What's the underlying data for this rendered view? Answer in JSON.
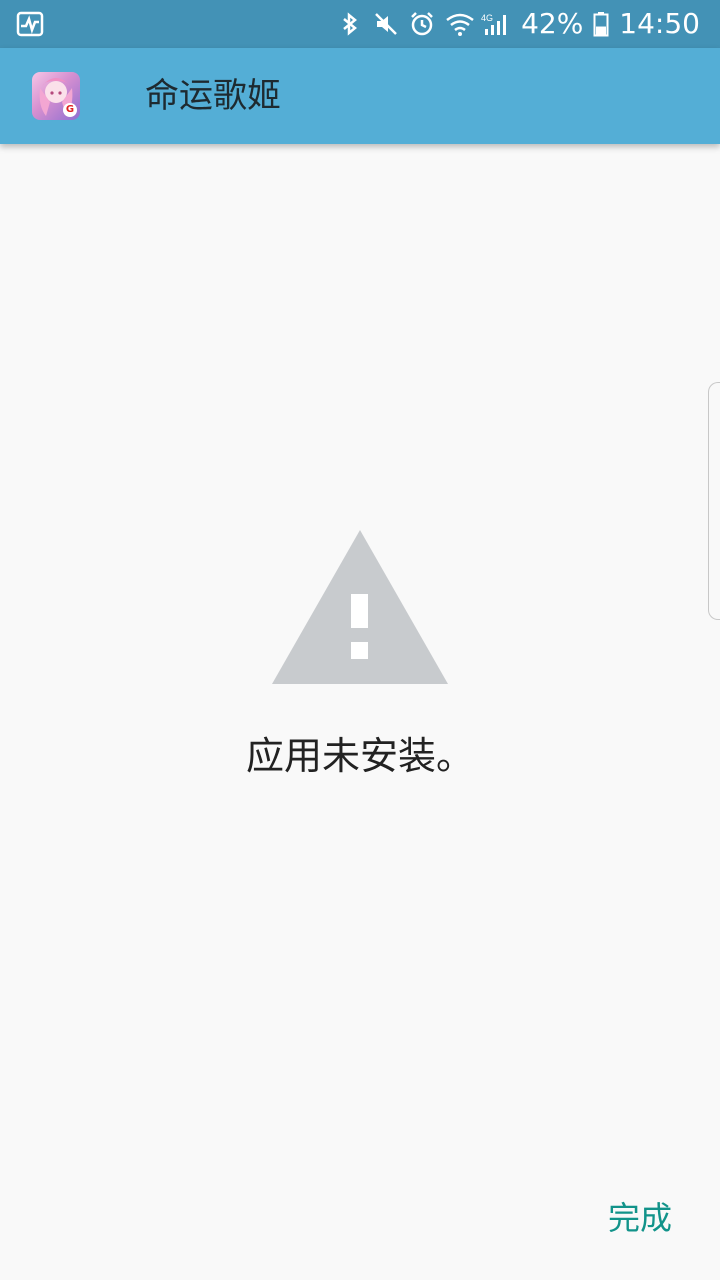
{
  "status_bar": {
    "battery_percent": "42%",
    "time": "14:50",
    "network_label": "4G",
    "icons": [
      "activity-icon",
      "bluetooth-icon",
      "mute-icon",
      "alarm-icon",
      "wifi-icon",
      "signal-icon",
      "battery-icon"
    ],
    "battery_level": 0.42
  },
  "app_bar": {
    "title": "命运歌姬",
    "app_icon_badge": "G"
  },
  "content": {
    "icon": "warning-icon",
    "message": "应用未安装。"
  },
  "footer": {
    "done_label": "完成"
  },
  "colors": {
    "status_bar_bg": "#4392b6",
    "app_bar_bg": "#54aed6",
    "accent": "#12938a",
    "warning_icon": "#c8cbce"
  }
}
